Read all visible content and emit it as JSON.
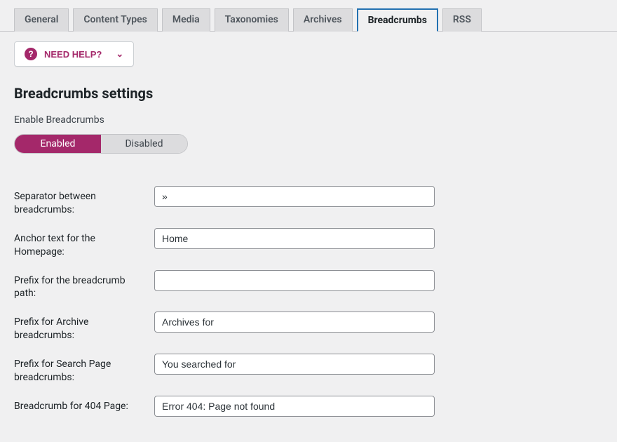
{
  "tabs": [
    {
      "label": "General"
    },
    {
      "label": "Content Types"
    },
    {
      "label": "Media"
    },
    {
      "label": "Taxonomies"
    },
    {
      "label": "Archives"
    },
    {
      "label": "Breadcrumbs"
    },
    {
      "label": "RSS"
    }
  ],
  "help_button": {
    "label": "NEED HELP?"
  },
  "section_title": "Breadcrumbs settings",
  "enable_label": "Enable Breadcrumbs",
  "toggle": {
    "enabled": "Enabled",
    "disabled": "Disabled"
  },
  "fields": {
    "separator": {
      "label": "Separator between breadcrumbs:",
      "value": "»"
    },
    "anchor": {
      "label": "Anchor text for the Homepage:",
      "value": "Home"
    },
    "prefix_path": {
      "label": "Prefix for the breadcrumb path:",
      "value": ""
    },
    "prefix_archive": {
      "label": "Prefix for Archive breadcrumbs:",
      "value": "Archives for"
    },
    "prefix_search": {
      "label": "Prefix for Search Page breadcrumbs:",
      "value": "You searched for"
    },
    "error404": {
      "label": "Breadcrumb for 404 Page:",
      "value": "Error 404: Page not found"
    }
  },
  "icons": {
    "chevron_down": "⌄",
    "question": "?"
  }
}
